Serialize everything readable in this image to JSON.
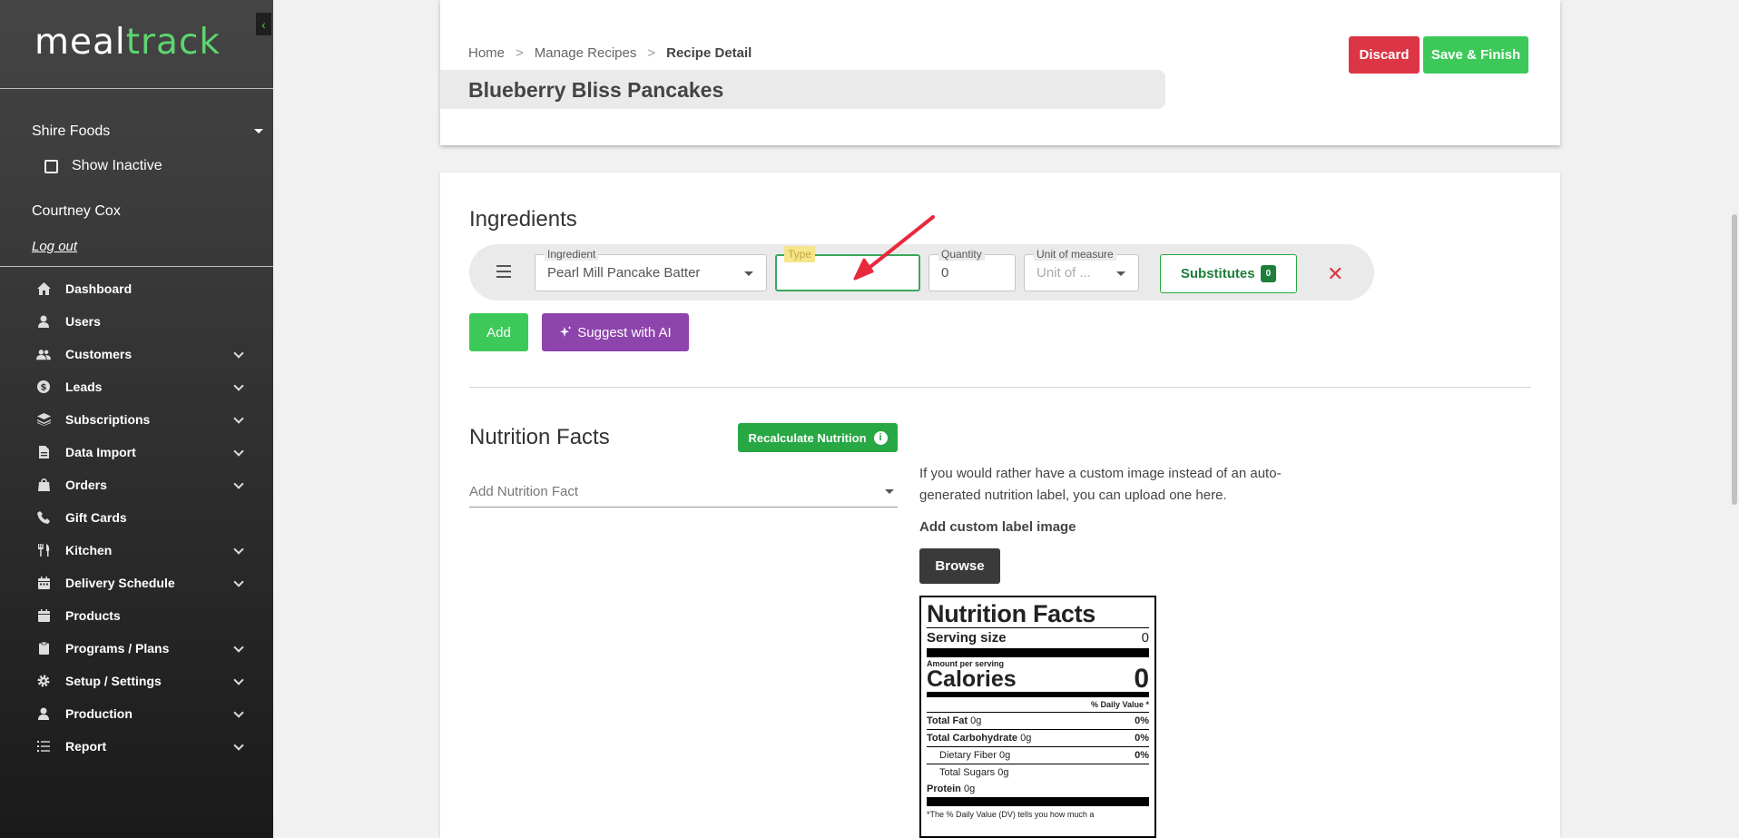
{
  "app": {
    "logo_part1": "meal",
    "logo_part2": "track"
  },
  "sidebar": {
    "company": "Shire Foods",
    "show_inactive": "Show Inactive",
    "user": "Courtney Cox",
    "logout": "Log out",
    "items": [
      {
        "label": "Dashboard",
        "icon": "home-icon",
        "chevron": false
      },
      {
        "label": "Users",
        "icon": "user-icon",
        "chevron": false
      },
      {
        "label": "Customers",
        "icon": "users-icon",
        "chevron": true
      },
      {
        "label": "Leads",
        "icon": "dollar-icon",
        "chevron": true
      },
      {
        "label": "Subscriptions",
        "icon": "layers-icon",
        "chevron": true
      },
      {
        "label": "Data Import",
        "icon": "file-icon",
        "chevron": true
      },
      {
        "label": "Orders",
        "icon": "bag-icon",
        "chevron": true
      },
      {
        "label": "Gift Cards",
        "icon": "phone-icon",
        "chevron": false
      },
      {
        "label": "Kitchen",
        "icon": "utensils-icon",
        "chevron": true
      },
      {
        "label": "Delivery Schedule",
        "icon": "calendar-icon",
        "chevron": true
      },
      {
        "label": "Products",
        "icon": "calendar-icon",
        "chevron": false
      },
      {
        "label": "Programs / Plans",
        "icon": "clipboard-icon",
        "chevron": true
      },
      {
        "label": "Setup / Settings",
        "icon": "gear-icon",
        "chevron": true
      },
      {
        "label": "Production",
        "icon": "user-icon",
        "chevron": true
      },
      {
        "label": "Report",
        "icon": "list-icon",
        "chevron": true
      }
    ]
  },
  "header": {
    "breadcrumb": [
      "Home",
      "Manage Recipes",
      "Recipe Detail"
    ],
    "breadcrumb_sep": ">",
    "title": "Blueberry Bliss Pancakes",
    "discard": "Discard",
    "save": "Save & Finish"
  },
  "ingredients": {
    "title": "Ingredients",
    "row": {
      "ingredient_label": "Ingredient",
      "ingredient_value": "Pearl Mill Pancake Batter",
      "type_label": "Type",
      "type_value": "",
      "quantity_label": "Quantity",
      "quantity_value": "0",
      "unit_label": "Unit of measure",
      "unit_placeholder": "Unit of ...",
      "substitutes": "Substitutes",
      "substitutes_count": "0",
      "remove": "✕"
    },
    "add": "Add",
    "suggest": "Suggest with AI"
  },
  "nutrition": {
    "title": "Nutrition Facts",
    "recalc": "Recalculate Nutrition",
    "add_fact_placeholder": "Add Nutrition Fact",
    "custom_note": "If you would rather have a custom image instead of an auto-generated nutrition label, you can upload one here.",
    "add_custom_label": "Add custom label image",
    "browse": "Browse",
    "label": {
      "title": "Nutrition Facts",
      "serving_size": "Serving size",
      "serving_value": "0",
      "amount_per_serving": "Amount per serving",
      "calories": "Calories",
      "calories_value": "0",
      "dv_header": "% Daily Value *",
      "rows": [
        {
          "name": "Total Fat",
          "amount": "0g",
          "dv": "0%"
        },
        {
          "name": "Total Carbohydrate",
          "amount": "0g",
          "dv": "0%"
        },
        {
          "name": "Dietary Fiber",
          "amount": "0g",
          "dv": "0%"
        },
        {
          "name": "Total Sugars",
          "amount": "0g",
          "dv": ""
        },
        {
          "name": "Protein",
          "amount": "0g",
          "dv": ""
        }
      ],
      "footnote": "*The % Daily Value (DV) tells you how much a"
    }
  },
  "colors": {
    "accent_green": "#3cc95a",
    "danger_red": "#dc3545",
    "ai_purple": "#8e44ad",
    "annotation_red": "#e8283c"
  }
}
